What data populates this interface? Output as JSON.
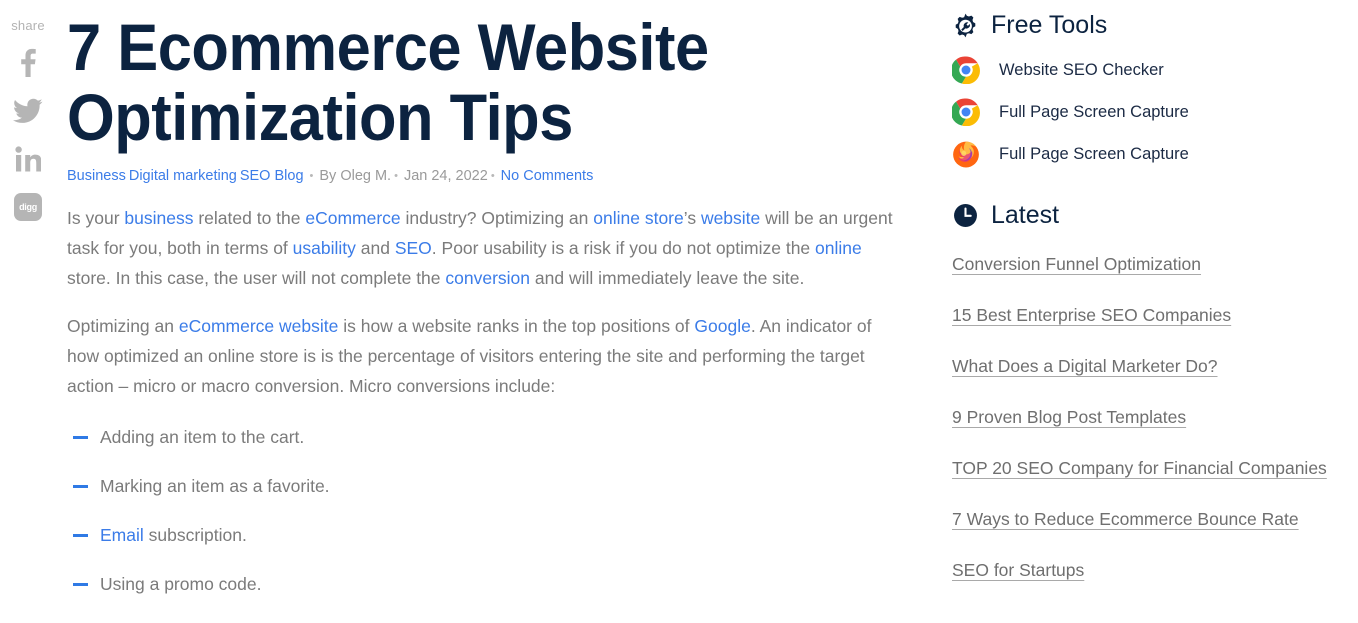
{
  "share": {
    "label": "share",
    "buttons": [
      {
        "name": "facebook",
        "title": "Share on Facebook"
      },
      {
        "name": "twitter",
        "title": "Share on Twitter"
      },
      {
        "name": "linkedin",
        "title": "Share on LinkedIn"
      },
      {
        "name": "digg",
        "title": "Share on Digg",
        "badge_text": "digg"
      }
    ]
  },
  "article": {
    "title": "7 Ecommerce Website\nOptimization Tips",
    "meta": {
      "categories": [
        "Business",
        "Digital marketing",
        "SEO Blog"
      ],
      "separator": "•",
      "author": "By Oleg M.",
      "date": "Jan 24, 2022",
      "comments": "No Comments"
    },
    "paragraph1": [
      {
        "t": "Is your ",
        "link": false
      },
      {
        "t": "business",
        "link": true
      },
      {
        "t": " related to the ",
        "link": false
      },
      {
        "t": "eCommerce",
        "link": true
      },
      {
        "t": " industry? Optimizing an ",
        "link": false
      },
      {
        "t": "online store",
        "link": true
      },
      {
        "t": "’s ",
        "link": false
      },
      {
        "t": "website",
        "link": true
      },
      {
        "t": " will be an urgent task for you, both in terms of ",
        "link": false
      },
      {
        "t": "usability",
        "link": true
      },
      {
        "t": " and ",
        "link": false
      },
      {
        "t": "SEO",
        "link": true
      },
      {
        "t": ". Poor usability is a risk if you do not optimize the ",
        "link": false
      },
      {
        "t": "online",
        "link": true
      },
      {
        "t": " store. In this case, the user will not complete the ",
        "link": false
      },
      {
        "t": "conversion",
        "link": true
      },
      {
        "t": " and will immediately leave the site.",
        "link": false
      }
    ],
    "paragraph2": [
      {
        "t": "Optimizing an ",
        "link": false
      },
      {
        "t": "eCommerce website",
        "link": true
      },
      {
        "t": " is how a website ranks in the top positions of ",
        "link": false
      },
      {
        "t": "Google",
        "link": true
      },
      {
        "t": ". An indicator of how optimized an online store is is the percentage of visitors entering the site and performing the target action – micro or macro conversion. Micro conversions include:",
        "link": false
      }
    ],
    "micro_list": [
      [
        {
          "t": "Adding an item to the cart.",
          "link": false
        }
      ],
      [
        {
          "t": "Marking an item as a favorite.",
          "link": false
        }
      ],
      [
        {
          "t": "Email",
          "link": true
        },
        {
          "t": " subscription.",
          "link": false
        }
      ],
      [
        {
          "t": "Using a promo code.",
          "link": false
        }
      ]
    ]
  },
  "sidebar": {
    "free_tools": {
      "title": "Free Tools",
      "icon": "gear-icon",
      "items": [
        {
          "label": "Website SEO Checker",
          "icon": "chrome-icon"
        },
        {
          "label": "Full Page Screen Capture",
          "icon": "chrome-icon"
        },
        {
          "label": "Full Page Screen Capture",
          "icon": "firefox-icon"
        }
      ]
    },
    "latest": {
      "title": "Latest",
      "icon": "clock-icon",
      "items": [
        "Conversion Funnel Optimization",
        "15 Best Enterprise SEO Companies",
        "What Does a Digital Marketer Do?",
        "9 Proven Blog Post Templates",
        "TOP 20 SEO Company for Financial Companies",
        "7 Ways to Reduce Ecommerce Bounce Rate",
        "SEO for Startups"
      ]
    }
  },
  "colors": {
    "title_navy": "#0c2340",
    "link_blue": "#3b7ce8",
    "body_gray": "#7b7b7b",
    "share_gray": "#b5b5b5",
    "latest_link_gray": "#6f6f6f"
  }
}
